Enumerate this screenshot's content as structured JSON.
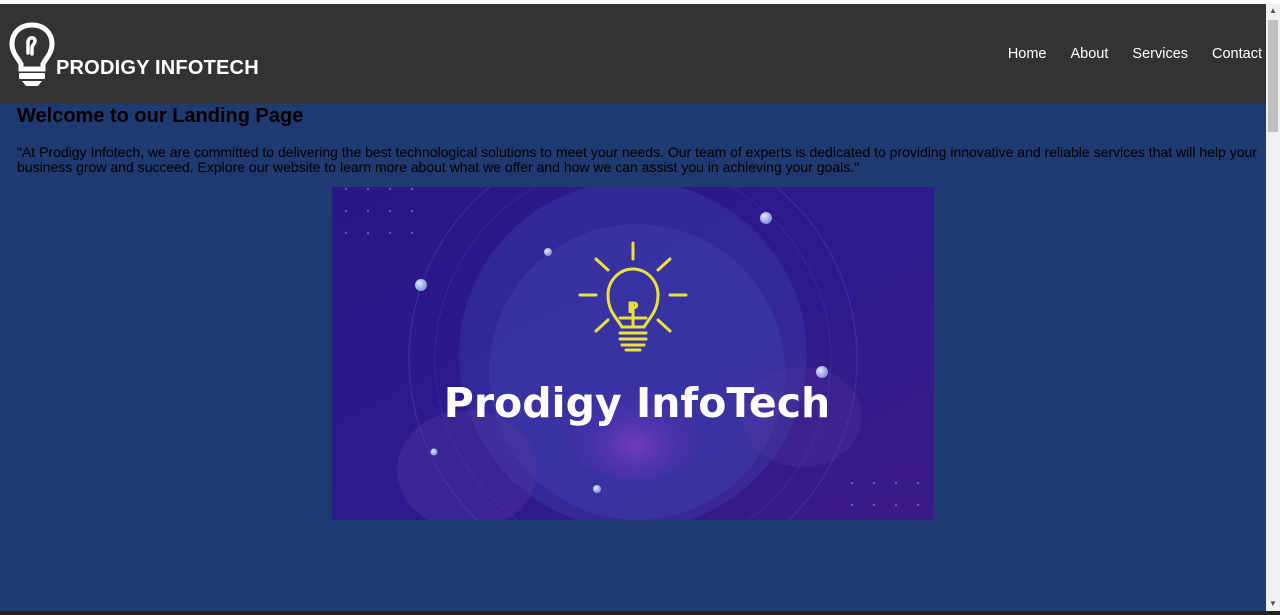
{
  "navbar": {
    "brand": "PRODIGY INFOTECH",
    "links": [
      "Home",
      "About",
      "Services",
      "Contact"
    ],
    "background": "#333333"
  },
  "main": {
    "heading": "Welcome to our Landing Page",
    "intro": "\"At Prodigy Infotech, we are committed to delivering the best technological solutions to meet your needs. Our team of experts is dedicated to providing innovative and reliable services that will help your business grow and succeed. Explore our website to learn more about what we offer and how we can assist you in achieving your goals.\"",
    "background": "#1e3a70"
  },
  "hero": {
    "title": "Prodigy InfoTech",
    "bulb_letter": "P",
    "bulb_color": "#e8e23a",
    "background": "#2e1a86"
  },
  "icons": {
    "logo": "lightbulb-icon",
    "scroll_up": "chevron-up-icon",
    "scroll_down": "chevron-down-icon"
  }
}
